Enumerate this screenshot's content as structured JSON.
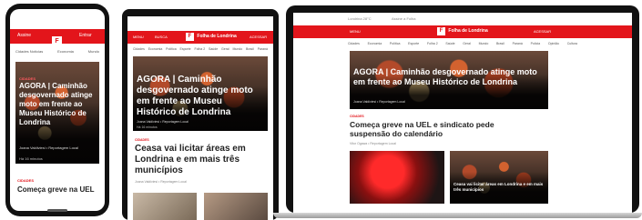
{
  "brand": {
    "name": "Folha de Londrina",
    "accent": "#e3151b"
  },
  "header": {
    "menu": "MENU",
    "search": "BUSCA",
    "account": "ACESSAR",
    "login": "Assine"
  },
  "topbar": {
    "left": "Londrina 28°C",
    "mid": "Assine a Folha"
  },
  "nav": [
    "Cidades",
    "Economia",
    "Política",
    "Esporte",
    "Folha 2",
    "Saúde",
    "Geral",
    "Mundo",
    "Brasil",
    "Paraná",
    "Polícia",
    "Opinião",
    "Cultura"
  ],
  "phone": {
    "header_links": [
      "Assine",
      "Entrar",
      "Sair"
    ],
    "submenu": [
      "Cidades Notícias",
      "Economia",
      "Mundo"
    ],
    "hero_tag": "CIDADES",
    "hero_title": "AGORA | Caminhão desgovernado atinge moto em frente ao Museu Histórico de Londrina",
    "hero_meta": "Joana Valdiviesi • Reportagem Local",
    "hero_date": "Há 16 minutos",
    "second_tag": "CIDADES",
    "second_title": "Começa greve na UEL"
  },
  "tablet": {
    "hero_title": "AGORA | Caminhão desgovernado atinge moto em frente ao Museu Histórico de Londrina",
    "hero_meta": "Joana Valdiviesi • Reportagem Local",
    "hero_date": "Há 16 minutos",
    "second_tag": "CIDADES",
    "second_title": "Ceasa vai licitar áreas em Londrina e em mais três municípios",
    "second_meta": "Joana Valdiviesi • Reportagem Local"
  },
  "laptop": {
    "hero_title": "AGORA | Caminhão desgovernado atinge moto em frente ao Museu Histórico de Londrina",
    "hero_meta": "Joana Valdiviesi • Reportagem Local",
    "second_tag": "CIDADES",
    "second_title": "Começa greve na UEL e sindicato pede suspensão do calendário",
    "second_meta": "Vitor Ogawa • Reportagem Local",
    "third_title": "Ceasa vai licitar áreas em Londrina e em mais três municípios"
  }
}
